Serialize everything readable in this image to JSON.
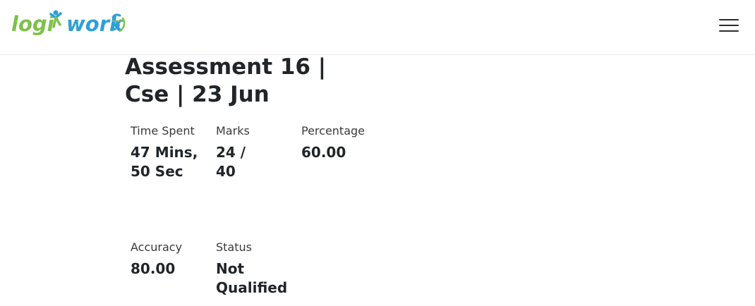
{
  "brand": {
    "logo_text_left": "logi",
    "logo_text_right": "work",
    "colors": {
      "green": "#7cc24a",
      "blue": "#2f9fd8"
    }
  },
  "nav": {
    "menu_icon": "hamburger-menu-icon"
  },
  "assessment": {
    "title": "Assessment 16 | Cse | 23 Jun"
  },
  "stats": {
    "time_spent": {
      "label": "Time Spent",
      "value": "47 Mins, 50 Sec"
    },
    "marks": {
      "label": "Marks",
      "value": "24 / 40"
    },
    "percentage": {
      "label": "Percentage",
      "value": "60.00"
    },
    "accuracy": {
      "label": "Accuracy",
      "value": "80.00"
    },
    "status": {
      "label": "Status",
      "value": "Not Qualified"
    }
  }
}
